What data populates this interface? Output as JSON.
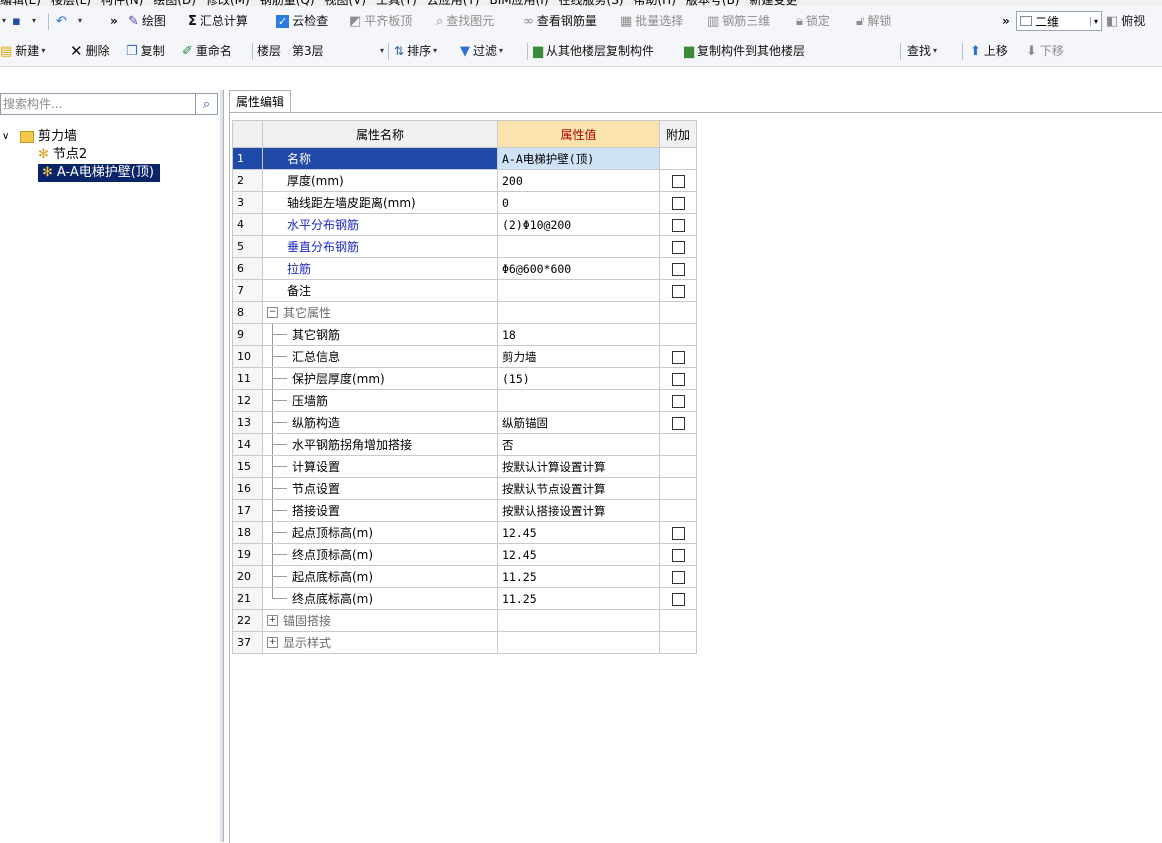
{
  "menu": [
    "编辑(E)",
    "楼层(L)",
    "构件(N)",
    "绘图(D)",
    "修改(M)",
    "钢筋量(Q)",
    "视图(V)",
    "工具(T)",
    "云应用(Y)",
    "BIM应用(I)",
    "在线服务(S)",
    "帮助(H)",
    "版本号(B)",
    "新建变更"
  ],
  "toolbar1": {
    "more": "»",
    "draw": "绘图",
    "sum_calc": "汇总计算",
    "cloud_check": "云检查",
    "flat_slab_top": "平齐板顶",
    "find_element": "查找图元",
    "view_rebar": "查看钢筋量",
    "batch_select": "批量选择",
    "rebar_3d": "钢筋三维",
    "lock": "锁定",
    "unlock": "解锁",
    "more2": "»",
    "view_mode": "二维",
    "top_view": "俯视"
  },
  "toolbar2": {
    "new": "新建",
    "delete": "删除",
    "copy": "复制",
    "rename": "重命名",
    "floor_label": "楼层",
    "floor_value": "第3层",
    "sort": "排序",
    "filter": "过滤",
    "copy_from_floor": "从其他楼层复制构件",
    "copy_to_floor": "复制构件到其他楼层",
    "find": "查找",
    "move_up": "上移",
    "move_down": "下移"
  },
  "left": {
    "search_placeholder": "搜索构件...",
    "tree_root": "剪力墙",
    "tree_children": [
      "节点2",
      "A-A电梯护壁(顶)"
    ]
  },
  "editor": {
    "tab": "属性编辑",
    "col_name": "属性名称",
    "col_value": "属性值",
    "col_add": "附加",
    "rows": [
      {
        "num": "1",
        "name": "名称",
        "value": "A-A电梯护壁(顶)",
        "check": false,
        "style": "normal",
        "level": 0,
        "selected": true
      },
      {
        "num": "2",
        "name": "厚度(mm)",
        "value": "200",
        "check": true,
        "style": "normal",
        "level": 0
      },
      {
        "num": "3",
        "name": "轴线距左墙皮距离(mm)",
        "value": "0",
        "check": true,
        "style": "normal",
        "level": 0
      },
      {
        "num": "4",
        "name": "水平分布钢筋",
        "value": "(2)Φ10@200",
        "check": true,
        "style": "blue",
        "level": 0
      },
      {
        "num": "5",
        "name": "垂直分布钢筋",
        "value": "",
        "check": true,
        "style": "blue",
        "level": 0
      },
      {
        "num": "6",
        "name": "拉筋",
        "value": "Φ6@600*600",
        "check": true,
        "style": "blue",
        "level": 0
      },
      {
        "num": "7",
        "name": "备注",
        "value": "",
        "check": true,
        "style": "normal",
        "level": 0
      },
      {
        "num": "8",
        "name": "其它属性",
        "value": "",
        "check": false,
        "style": "group",
        "level": 0,
        "pm": "−"
      },
      {
        "num": "9",
        "name": "其它钢筋",
        "value": "18",
        "check": false,
        "style": "normal",
        "level": 1
      },
      {
        "num": "10",
        "name": "汇总信息",
        "value": "剪力墙",
        "check": true,
        "style": "normal",
        "level": 1
      },
      {
        "num": "11",
        "name": "保护层厚度(mm)",
        "value": "(15)",
        "check": true,
        "style": "normal",
        "level": 1
      },
      {
        "num": "12",
        "name": "压墙筋",
        "value": "",
        "check": true,
        "style": "normal",
        "level": 1
      },
      {
        "num": "13",
        "name": "纵筋构造",
        "value": "纵筋锚固",
        "check": true,
        "style": "normal",
        "level": 1
      },
      {
        "num": "14",
        "name": "水平钢筋拐角增加搭接",
        "value": "否",
        "check": false,
        "style": "normal",
        "level": 1
      },
      {
        "num": "15",
        "name": "计算设置",
        "value": "按默认计算设置计算",
        "check": false,
        "style": "normal",
        "level": 1
      },
      {
        "num": "16",
        "name": "节点设置",
        "value": "按默认节点设置计算",
        "check": false,
        "style": "normal",
        "level": 1
      },
      {
        "num": "17",
        "name": "搭接设置",
        "value": "按默认搭接设置计算",
        "check": false,
        "style": "normal",
        "level": 1
      },
      {
        "num": "18",
        "name": "起点顶标高(m)",
        "value": "12.45",
        "check": true,
        "style": "normal",
        "level": 1
      },
      {
        "num": "19",
        "name": "终点顶标高(m)",
        "value": "12.45",
        "check": true,
        "style": "normal",
        "level": 1
      },
      {
        "num": "20",
        "name": "起点底标高(m)",
        "value": "11.25",
        "check": true,
        "style": "normal",
        "level": 1
      },
      {
        "num": "21",
        "name": "终点底标高(m)",
        "value": "11.25",
        "check": true,
        "style": "normal",
        "level": 1,
        "last": true
      },
      {
        "num": "22",
        "name": "锚固搭接",
        "value": "",
        "check": false,
        "style": "group",
        "level": 0,
        "pm": "+"
      },
      {
        "num": "37",
        "name": "显示样式",
        "value": "",
        "check": false,
        "style": "group",
        "level": 0,
        "pm": "+"
      }
    ]
  },
  "colors": {
    "selected_row": "#1f4aa8",
    "value_header_bg": "#fbe3ae",
    "value_header_text": "#b00000",
    "link_blue": "#1c28c8"
  }
}
